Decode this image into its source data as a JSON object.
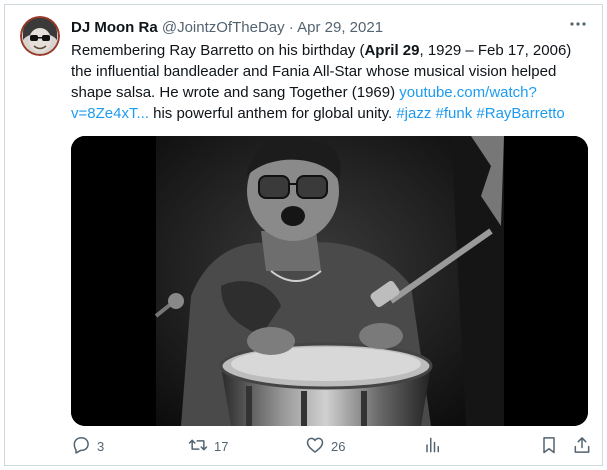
{
  "tweet": {
    "author_name": "DJ Moon Ra",
    "handle": "@JointzOfTheDay",
    "separator": "·",
    "date": "Apr 29, 2021",
    "text_1": "Remembering Ray Barretto on his birthday (",
    "text_bold": "April 29",
    "text_2": ", 1929 – Feb 17, 2006) the influential bandleader and Fania All-Star whose musical vision helped shape salsa. He wrote and sang Together (1969) ",
    "link_url": "youtube.com/watch?v=8Ze4xT...",
    "text_3": " his powerful anthem for global unity. ",
    "hashtags": [
      "#jazz",
      "#funk",
      "#RayBarretto"
    ]
  },
  "actions": {
    "replies": "3",
    "retweets": "17",
    "likes": "26"
  },
  "icons": {
    "more": "more-dots-icon",
    "reply": "reply-icon",
    "retweet": "retweet-icon",
    "like": "heart-icon",
    "views": "views-icon",
    "bookmark": "bookmark-icon",
    "share": "share-icon"
  },
  "colors": {
    "link": "#1d9bf0",
    "muted": "#536471",
    "text": "#0f1419"
  }
}
